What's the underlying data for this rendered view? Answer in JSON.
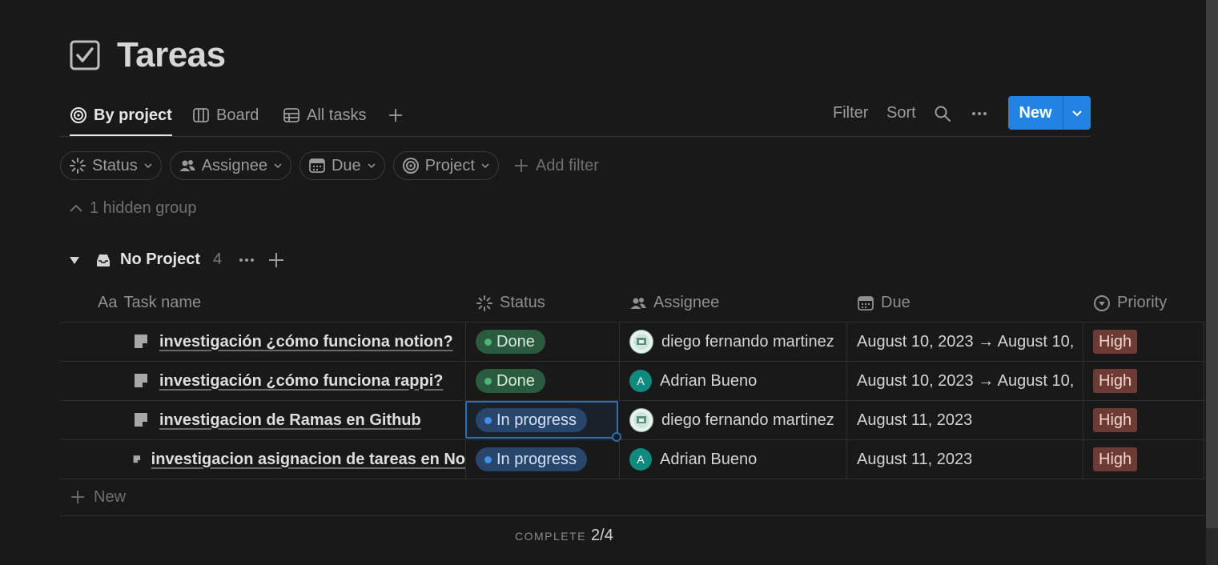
{
  "page": {
    "title": "Tareas",
    "title_icon": "checkbox-icon"
  },
  "views": {
    "tabs": [
      {
        "label": "By project",
        "icon": "target-icon",
        "active": true
      },
      {
        "label": "Board",
        "icon": "board-icon",
        "active": false
      },
      {
        "label": "All tasks",
        "icon": "table-icon",
        "active": false
      }
    ],
    "filter_label": "Filter",
    "sort_label": "Sort",
    "new_label": "New"
  },
  "filters": {
    "pills": [
      {
        "label": "Status",
        "icon": "status-icon"
      },
      {
        "label": "Assignee",
        "icon": "people-icon"
      },
      {
        "label": "Due",
        "icon": "calendar-icon"
      },
      {
        "label": "Project",
        "icon": "target-icon"
      }
    ],
    "add_filter_label": "Add filter"
  },
  "hidden_group_label": "1 hidden group",
  "group": {
    "title": "No Project",
    "count": "4",
    "icon": "inbox-icon"
  },
  "columns": {
    "task": {
      "prefix": "Aa",
      "label": "Task name"
    },
    "status": {
      "label": "Status"
    },
    "assignee": {
      "label": "Assignee"
    },
    "due": {
      "label": "Due"
    },
    "priority": {
      "label": "Priority"
    }
  },
  "rows": [
    {
      "name": "investigación ¿cómo funciona notion?",
      "status": "Done",
      "assignee": "diego fernando martinez",
      "avatar": "photo",
      "due": "August 10, 2023 → August 10,",
      "priority": "High"
    },
    {
      "name": "investigación ¿cómo funciona rappi?",
      "status": "Done",
      "assignee": "Adrian Bueno",
      "avatar": "A",
      "due": "August 10, 2023 → August 10,",
      "priority": "High"
    },
    {
      "name": "investigacion de Ramas en Github",
      "status": "In progress",
      "assignee": "diego fernando martinez",
      "avatar": "photo",
      "due": "August 11, 2023",
      "priority": "High"
    },
    {
      "name": "investigacion asignacion de tareas en No",
      "status": "In progress",
      "assignee": "Adrian Bueno",
      "avatar": "A",
      "due": "August 11, 2023",
      "priority": "High"
    }
  ],
  "new_row_label": "New",
  "footer": {
    "complete_label": "COMPLETE",
    "complete_value": "2/4"
  },
  "colors": {
    "accent": "#2383e2",
    "done": "#2b5b3f",
    "in_progress": "#28456c",
    "high": "#6e3a34"
  }
}
